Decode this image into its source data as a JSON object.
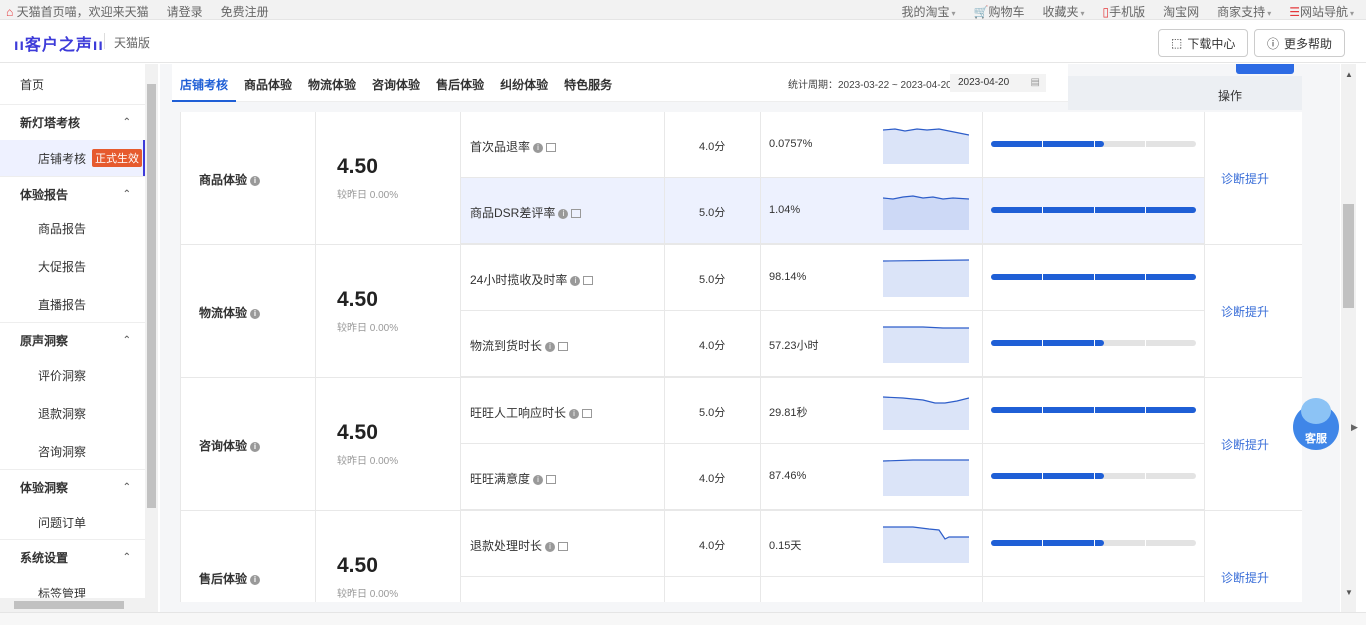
{
  "topbar": {
    "welcome": "天猫首页喵，欢迎来天猫",
    "login": "请登录",
    "register": "免费注册",
    "right": [
      "我的淘宝",
      "购物车",
      "收藏夹",
      "手机版",
      "淘宝网",
      "商家支持",
      "网站导航"
    ]
  },
  "header": {
    "logo": "客户之声",
    "logo_sub": "天猫版",
    "download": "下载中心",
    "help": "更多帮助"
  },
  "sidebar": {
    "home": "首页",
    "g1": "新灯塔考核",
    "g1_item": "店铺考核",
    "badge": "正式生效",
    "g2": "体验报告",
    "g2_items": [
      "商品报告",
      "大促报告",
      "直播报告"
    ],
    "g3": "原声洞察",
    "g3_items": [
      "评价洞察",
      "退款洞察",
      "咨询洞察"
    ],
    "g4": "体验洞察",
    "g4_items": [
      "问题订单"
    ],
    "g5": "系统设置",
    "g5_items": [
      "标签管理"
    ]
  },
  "tabs": [
    "店铺考核",
    "商品体验",
    "物流体验",
    "咨询体验",
    "售后体验",
    "纠纷体验",
    "特色服务"
  ],
  "period": "统计周期：2023-03-22 ~ 2023-04-20",
  "date": "2023-04-20",
  "op_header": "操作",
  "action_label": "诊断提升",
  "groups": [
    {
      "name": "商品体验",
      "score": "4.50",
      "sub": "较昨日 0.00%",
      "metrics": [
        {
          "name": "首次品退率",
          "score": "4.0分",
          "value": "0.0757%",
          "progress": 0.55
        },
        {
          "name": "商品DSR差评率",
          "score": "5.0分",
          "value": "1.04%",
          "progress": 1.0
        }
      ]
    },
    {
      "name": "物流体验",
      "score": "4.50",
      "sub": "较昨日 0.00%",
      "metrics": [
        {
          "name": "24小时揽收及时率",
          "score": "5.0分",
          "value": "98.14%",
          "progress": 1.0
        },
        {
          "name": "物流到货时长",
          "score": "4.0分",
          "value": "57.23小时",
          "progress": 0.55
        }
      ]
    },
    {
      "name": "咨询体验",
      "score": "4.50",
      "sub": "较昨日 0.00%",
      "metrics": [
        {
          "name": "旺旺人工响应时长",
          "score": "5.0分",
          "value": "29.81秒",
          "progress": 1.0
        },
        {
          "name": "旺旺满意度",
          "score": "4.0分",
          "value": "87.46%",
          "progress": 0.55
        }
      ]
    },
    {
      "name": "售后体验",
      "score": "4.50",
      "sub": "较昨日 0.00%",
      "metrics": [
        {
          "name": "退款处理时长",
          "score": "4.0分",
          "value": "0.15天",
          "progress": 0.55
        }
      ]
    }
  ],
  "service": "客服"
}
